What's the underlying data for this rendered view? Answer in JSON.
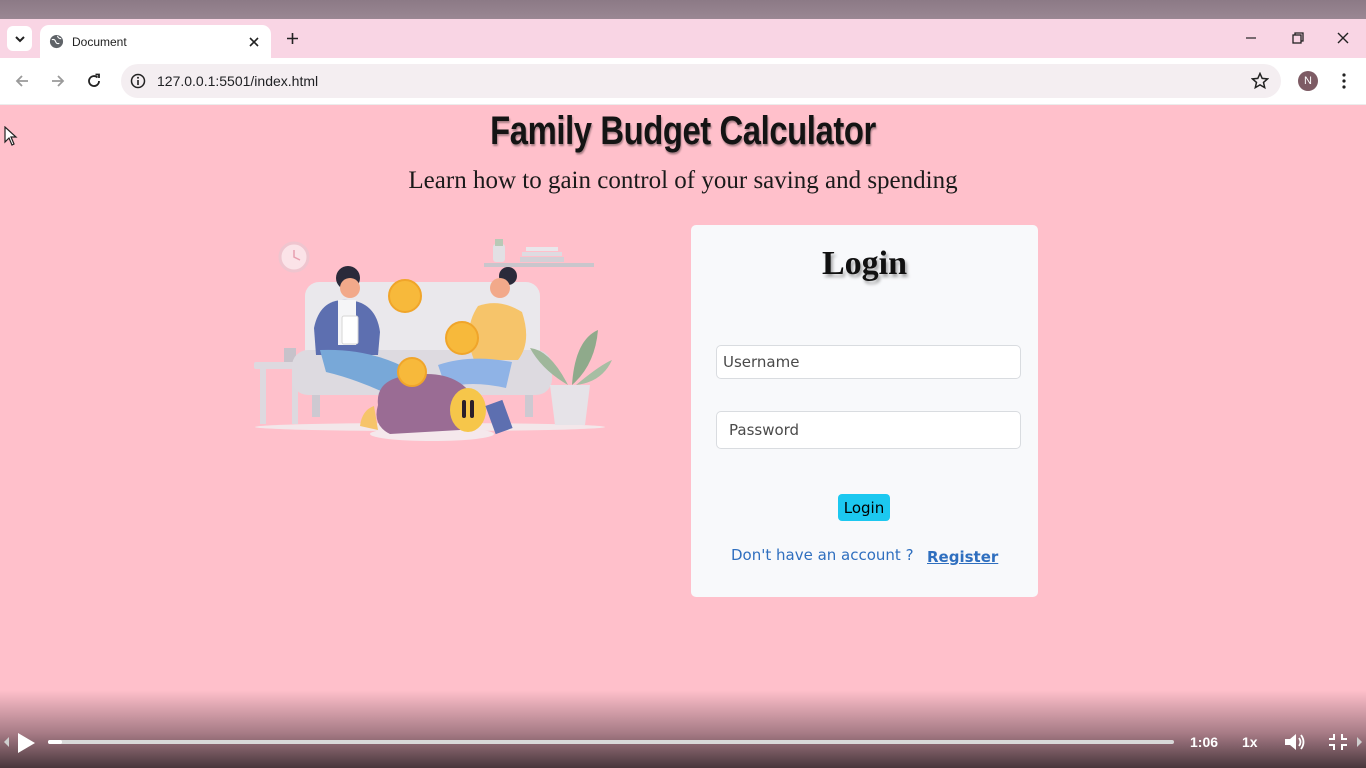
{
  "browser": {
    "tab_title": "Document",
    "url": "127.0.0.1:5501/index.html",
    "profile_initial": "N"
  },
  "page": {
    "title": "Family Budget Calculator",
    "subtitle": "Learn how to gain control of your saving and spending"
  },
  "login": {
    "heading": "Login",
    "username_placeholder": "Username",
    "password_placeholder": "Password",
    "button_label": "Login",
    "account_question": "Don't have an account ?",
    "register_label": "Register"
  },
  "video": {
    "time": "1:06",
    "speed": "1x",
    "progress": 0.012
  },
  "colors": {
    "page_background": "#ffc0cb",
    "login_button": "#1cc8f0",
    "link": "#2f6fbf"
  }
}
